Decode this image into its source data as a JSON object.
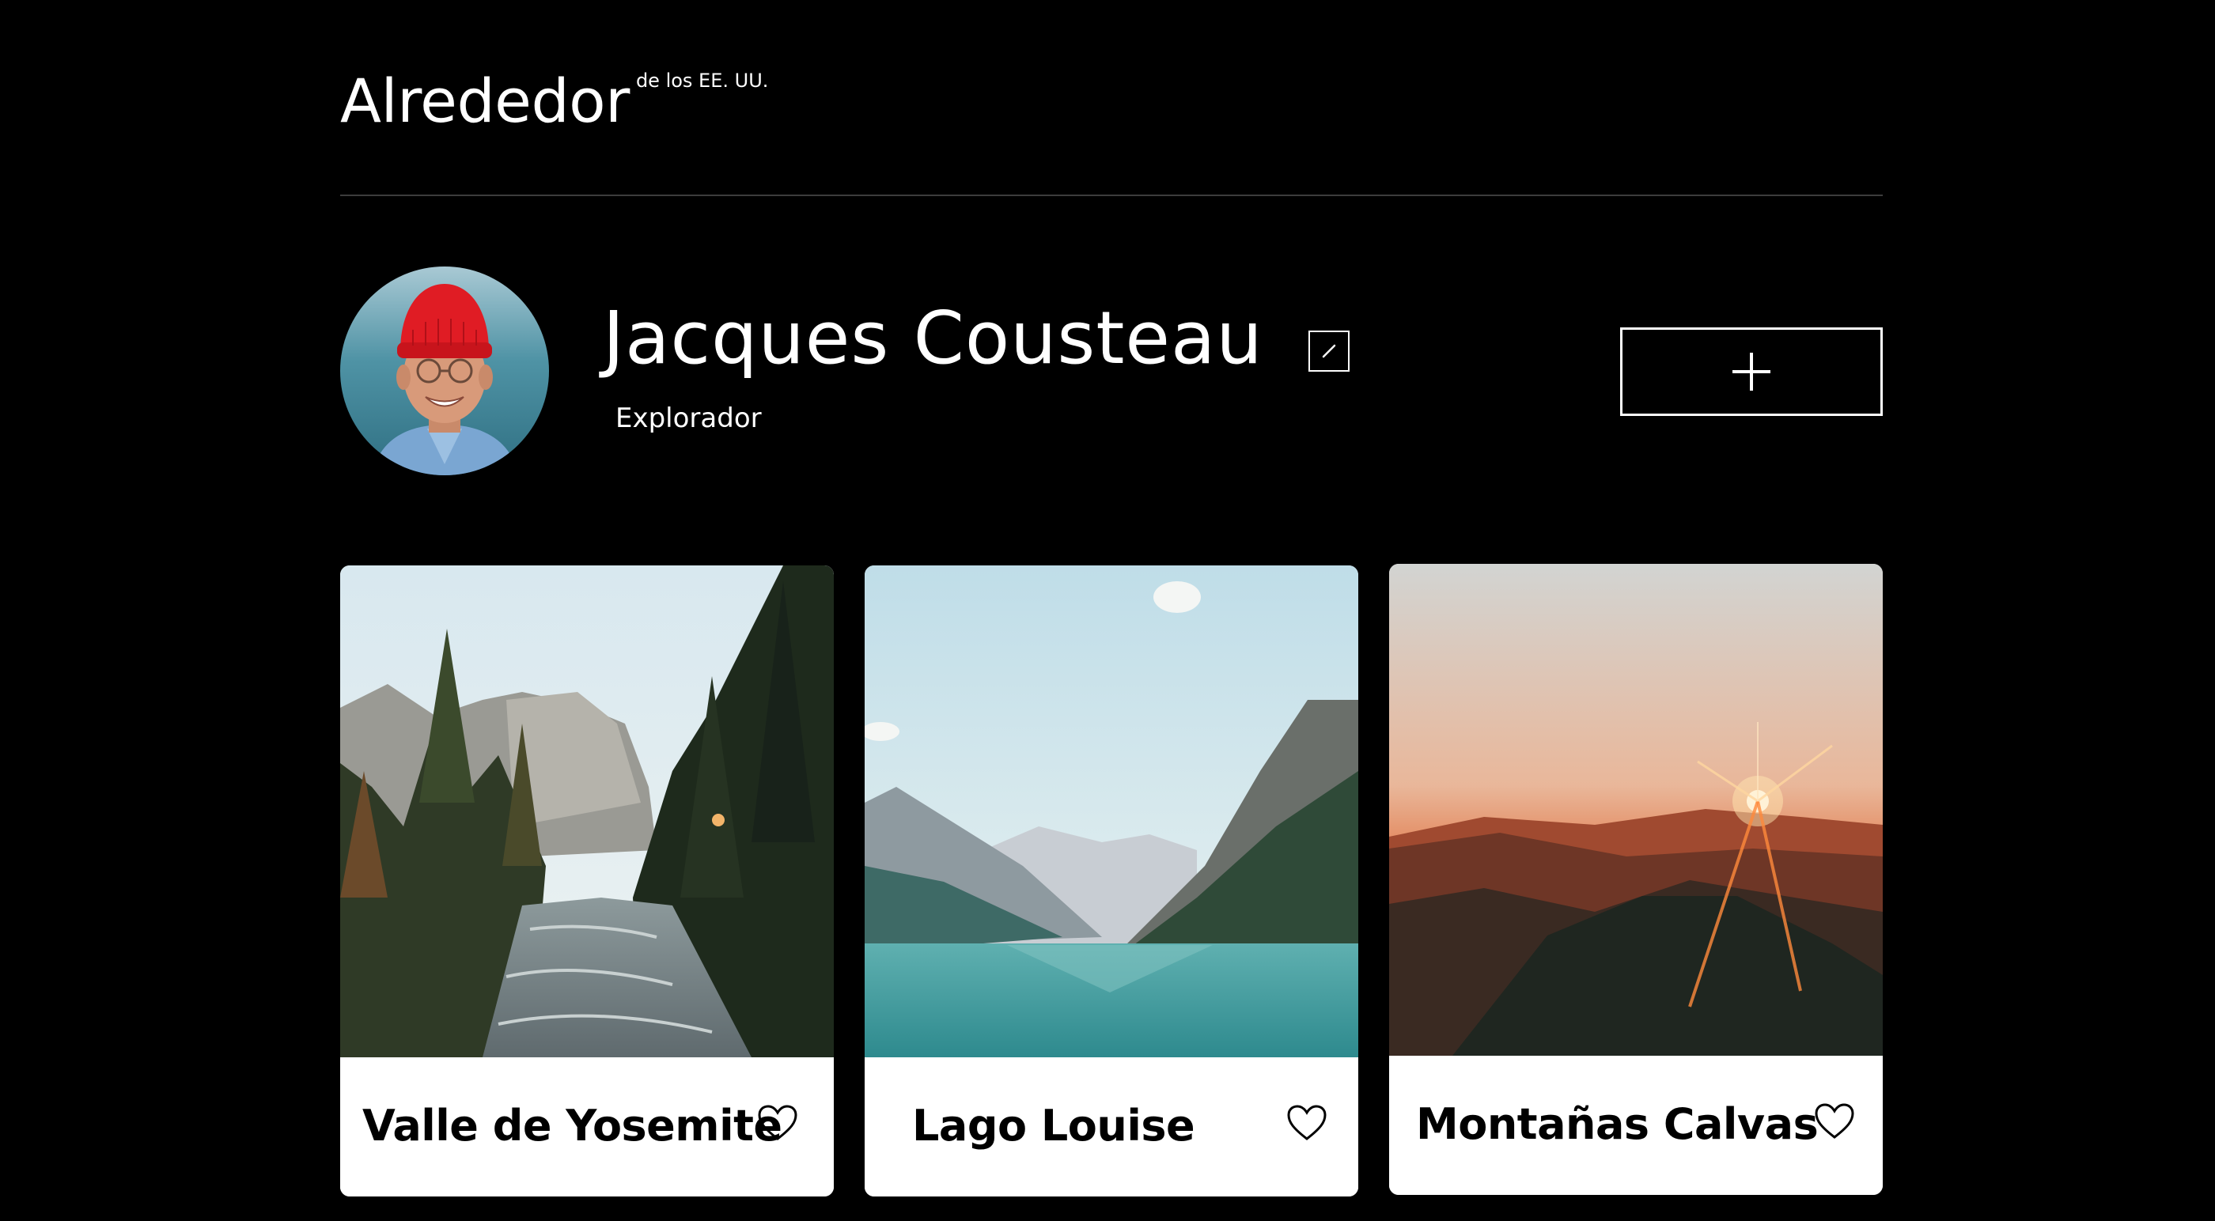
{
  "header": {
    "logo_main": "Alrededor",
    "logo_sub": "de los EE. UU."
  },
  "profile": {
    "name": "Jacques Cousteau",
    "role": "Explorador",
    "avatar_icon": "portrait-photo",
    "edit_icon": "pencil-icon",
    "add_icon": "plus-icon"
  },
  "cards": [
    {
      "title": "Valle de Yosemite",
      "image": "forest-river-photo",
      "icon": "heart-icon"
    },
    {
      "title": "Lago Louise",
      "image": "mountain-lake-photo",
      "icon": "heart-icon"
    },
    {
      "title": "Montañas Calvas",
      "image": "sunset-mountains-photo",
      "icon": "heart-icon"
    }
  ],
  "colors": {
    "background": "#000000",
    "text": "#ffffff",
    "card_background": "#ffffff",
    "card_text": "#000000",
    "divider": "#3c3c3c"
  }
}
